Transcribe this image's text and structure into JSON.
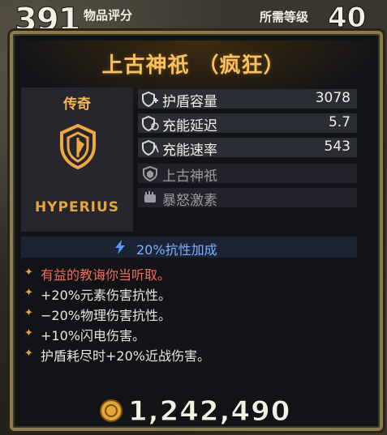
{
  "header": {
    "score": "391",
    "score_label": "物品评分",
    "level_label": "所需等级",
    "level": "40"
  },
  "item": {
    "name": "上古神祇 （疯狂）",
    "rarity": "传奇",
    "manufacturer": "HYPERIUS",
    "rarity_color": "#f5b552"
  },
  "stats": [
    {
      "name": "护盾容量",
      "value": "3078",
      "icon": "shield-capacity-icon"
    },
    {
      "name": "充能延迟",
      "value": "5.7",
      "icon": "shield-delay-icon"
    },
    {
      "name": "充能速率",
      "value": "543",
      "icon": "shield-rate-icon"
    },
    {
      "name": "上古神祇",
      "value": "",
      "icon": "shield-perk-icon"
    },
    {
      "name": "暴怒激素",
      "value": "",
      "icon": "fist-icon"
    }
  ],
  "bonus": {
    "text": "20%抗性加成",
    "icon": "lightning-icon",
    "color": "#7fb0ff"
  },
  "description": [
    {
      "text": "有益的教诲你当听取。",
      "style": "red"
    },
    {
      "text": "+20%元素伤害抗性。",
      "style": "normal"
    },
    {
      "text": "−20%物理伤害抗性。",
      "style": "normal"
    },
    {
      "text": "+10%闪电伤害。",
      "style": "normal"
    },
    {
      "text": "护盾耗尽时+20%近战伤害。",
      "style": "normal"
    }
  ],
  "price": {
    "value": "1,242,490",
    "icon": "coin-icon"
  }
}
